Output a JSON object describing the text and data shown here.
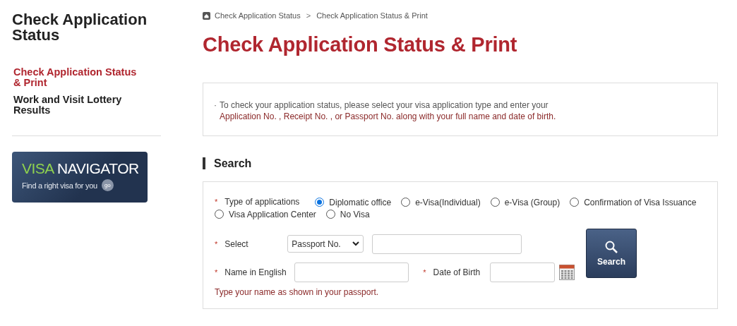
{
  "sidebar": {
    "title": "Check Application Status",
    "items": [
      {
        "label": "Check Application Status & Print",
        "selected": true
      },
      {
        "label": "Work and Visit Lottery Results",
        "selected": false
      }
    ],
    "banner": {
      "title_accent": "VISA",
      "title": "NAVIGATOR",
      "subtitle": "Find a right visa for you",
      "go": "go"
    }
  },
  "breadcrumb": [
    "Check Application Status",
    "Check Application Status & Print"
  ],
  "breadcrumb_separator": ">",
  "page_title": "Check Application Status & Print",
  "notice": {
    "bullet": "·",
    "line1": "To check your application status, please select your visa application type and enter your",
    "line2": "Application No. , Receipt No. , or Passport No. along with your full name and date of birth."
  },
  "section_title": "Search",
  "form": {
    "type_field": {
      "mark": "*",
      "label": "Type of applications",
      "options": [
        {
          "label": "Diplomatic office",
          "selected": true
        },
        {
          "label": "e-Visa(Individual)",
          "selected": false
        },
        {
          "label": "e-Visa (Group)",
          "selected": false
        },
        {
          "label": "Confirmation of Visa Issuance",
          "selected": false
        },
        {
          "label": "Visa Application Center",
          "selected": false
        },
        {
          "label": "No Visa",
          "selected": false
        }
      ]
    },
    "select_field": {
      "mark": "*",
      "label": "Select",
      "value": "Passport No."
    },
    "name_field": {
      "mark": "*",
      "label": "Name in English",
      "hint": "Type your name as shown in your passport."
    },
    "dob_field": {
      "mark": "*",
      "label": "Date of Birth"
    },
    "search_button": "Search"
  }
}
